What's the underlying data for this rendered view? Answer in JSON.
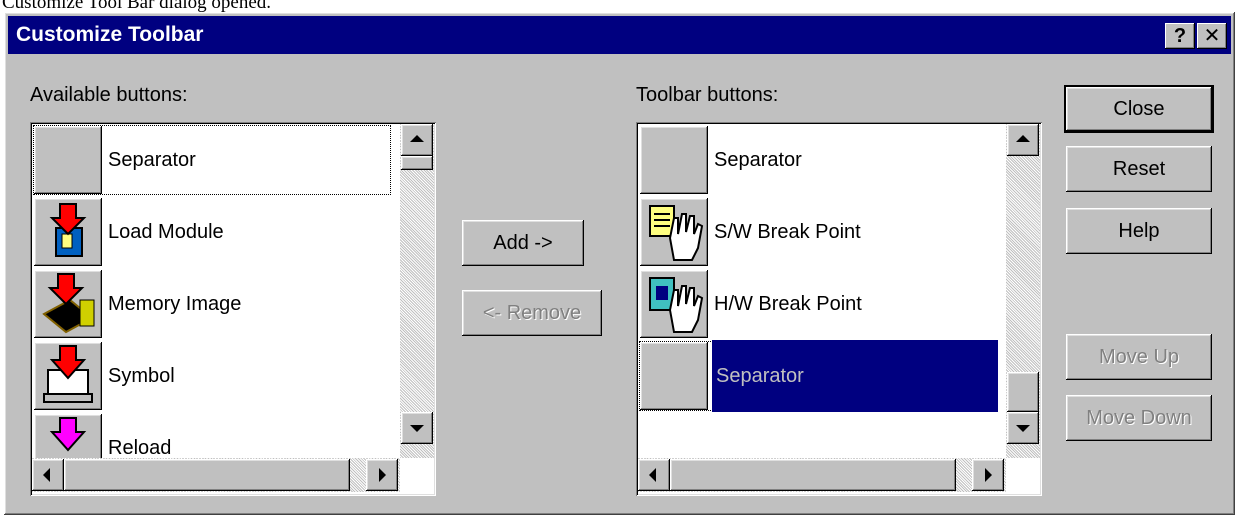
{
  "caption": "Customize Tool Bar dialog opened.",
  "dialog": {
    "title": "Customize Toolbar",
    "help_glyph": "?",
    "close_glyph": "✕"
  },
  "available": {
    "label": "Available buttons:",
    "items": [
      {
        "label": "Separator",
        "icon": "blank-icon"
      },
      {
        "label": "Load Module",
        "icon": "load-module-icon"
      },
      {
        "label": "Memory Image",
        "icon": "memory-image-icon"
      },
      {
        "label": "Symbol",
        "icon": "symbol-icon"
      },
      {
        "label": "Reload",
        "icon": "reload-icon"
      }
    ]
  },
  "toolbar": {
    "label": "Toolbar buttons:",
    "items": [
      {
        "label": "Separator",
        "icon": "blank-icon"
      },
      {
        "label": "S/W Break Point",
        "icon": "sw-breakpoint-icon"
      },
      {
        "label": "H/W Break Point",
        "icon": "hw-breakpoint-icon"
      },
      {
        "label": "Separator",
        "icon": "blank-icon",
        "selected": true
      }
    ]
  },
  "buttons": {
    "add": "Add ->",
    "remove": "<- Remove",
    "close": "Close",
    "reset": "Reset",
    "help": "Help",
    "move_up": "Move Up",
    "move_down": "Move Down"
  },
  "colors": {
    "title_bar": "#000080",
    "dialog_face": "#c0c0c0",
    "selection": "#000080"
  }
}
